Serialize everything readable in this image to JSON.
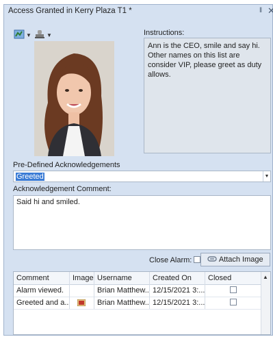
{
  "window": {
    "title": "Access Granted in Kerry Plaza T1  *",
    "pin_glyph": "‖",
    "close_glyph": "✕"
  },
  "toolbar": {
    "icons": [
      "map-icon",
      "stamp-icon"
    ],
    "colors": {
      "map": "#4a7fc0",
      "stamp": "#8a8a8a"
    }
  },
  "instructions": {
    "label": "Instructions:",
    "text": "Ann is the CEO, smile and say hi. Other names on this list are consider VIP, please greet as duty allows."
  },
  "acknowledgements": {
    "label": "Pre-Defined Acknowledgements",
    "selected": "Greeted"
  },
  "comment": {
    "label": "Acknowledgement Comment:",
    "value": "Said hi and smiled."
  },
  "close_alarm": {
    "label": "Close Alarm:",
    "checked": false
  },
  "attach": {
    "label": "Attach Image",
    "icon": "paperclip-icon"
  },
  "grid": {
    "columns": [
      "Comment",
      "Image",
      "Username",
      "Created On",
      "Closed"
    ],
    "rows": [
      {
        "comment": "Alarm viewed.",
        "image": "",
        "username": "Brian Matthew...",
        "created": "12/15/2021 3:...",
        "closed": false
      },
      {
        "comment": "Greeted and a...",
        "image": "image-thumbnail-icon",
        "username": "Brian Matthew...",
        "created": "12/15/2021 3:...",
        "closed": false
      }
    ]
  },
  "colors": {
    "panel": "#d5e1f1",
    "selection": "#3a7bd5"
  }
}
